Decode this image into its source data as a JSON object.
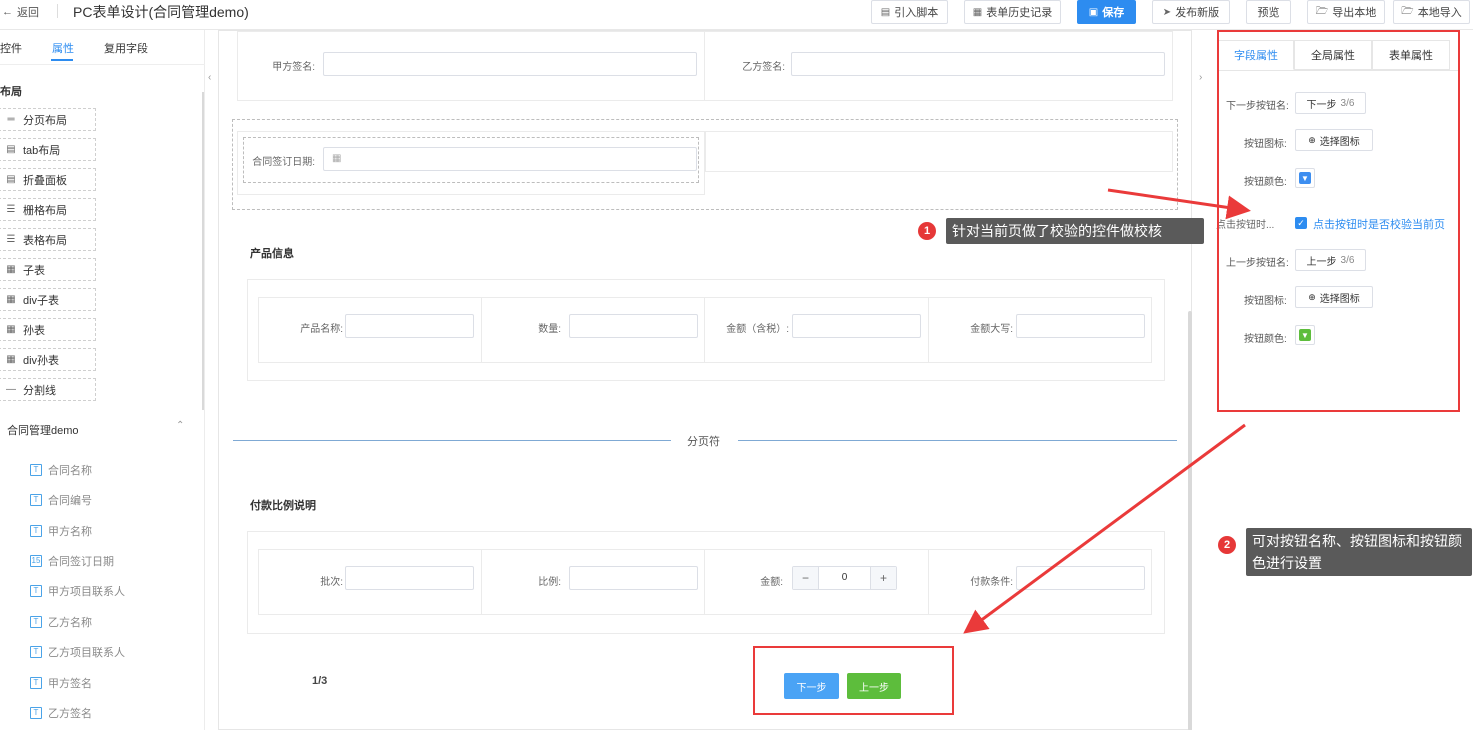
{
  "header": {
    "back_label": "返回",
    "title": "PC表单设计(合同管理demo)",
    "buttons": {
      "import_script": "引入脚本",
      "history": "表单历史记录",
      "save": "保存",
      "publish": "发布新版",
      "preview": "预览",
      "export": "导出本地",
      "import_local": "本地导入"
    }
  },
  "left": {
    "tabs": {
      "controls": "控件",
      "props": "属性",
      "reuse": "复用字段"
    },
    "layout_heading": "布局",
    "components": [
      {
        "label": "分页布局",
        "icon": "page-layout-icon"
      },
      {
        "label": "tab布局",
        "icon": "tab-layout-icon"
      },
      {
        "label": "折叠面板",
        "icon": "collapse-panel-icon"
      },
      {
        "label": "栅格布局",
        "icon": "grid-layout-icon"
      },
      {
        "label": "表格布局",
        "icon": "table-layout-icon"
      },
      {
        "label": "子表",
        "icon": "subtable-icon"
      },
      {
        "label": "div子表",
        "icon": "div-subtable-icon"
      },
      {
        "label": "孙表",
        "icon": "grandchild-table-icon"
      },
      {
        "label": "div孙表",
        "icon": "div-grandchild-table-icon"
      },
      {
        "label": "分割线",
        "icon": "divider-icon"
      }
    ],
    "group_title": "合同管理demo",
    "fields": [
      {
        "label": "合同名称",
        "icon": "T"
      },
      {
        "label": "合同编号",
        "icon": "T"
      },
      {
        "label": "甲方名称",
        "icon": "T"
      },
      {
        "label": "合同签订日期",
        "icon": "15"
      },
      {
        "label": "甲方项目联系人",
        "icon": "T"
      },
      {
        "label": "乙方名称",
        "icon": "T"
      },
      {
        "label": "乙方项目联系人",
        "icon": "T"
      },
      {
        "label": "甲方签名",
        "icon": "T"
      },
      {
        "label": "乙方签名",
        "icon": "T"
      }
    ]
  },
  "canvas": {
    "party_a_sign": "甲方签名:",
    "party_b_sign": "乙方签名:",
    "sign_date": "合同签订日期:",
    "product_section": "产品信息",
    "product_name": "产品名称:",
    "quantity": "数量:",
    "amount_tax": "金额（含税）:",
    "amount_upper": "金额大写:",
    "page_break": "分页符",
    "payment_section": "付款比例说明",
    "batch": "批次:",
    "ratio": "比例:",
    "amount": "金额:",
    "amount_value": "0",
    "pay_condition": "付款条件:",
    "page_indicator": "1/3",
    "next_button": "下一步",
    "prev_button": "上一步",
    "next_color": "#4aa3f5",
    "prev_color": "#5dbd3c"
  },
  "right": {
    "tabs": {
      "field": "字段属性",
      "global": "全局属性",
      "form": "表单属性"
    },
    "next_name_label": "下一步按钮名:",
    "next_name_value": "下一步",
    "next_name_count": "3/6",
    "icon_label": "按钮图标:",
    "choose_icon": "选择图标",
    "color_label": "按钮颜色:",
    "validate_label": "点击按钮时...",
    "validate_checkbox": "点击按钮时是否校验当前页",
    "prev_name_label": "上一步按钮名:",
    "prev_name_value": "上一步",
    "prev_name_count": "3/6",
    "prev_icon_label": "按钮图标:",
    "prev_color_label": "按钮颜色:",
    "next_swatch_color": "#3d8ef0",
    "prev_swatch_color": "#5dbd3c"
  },
  "annotations": {
    "tip1_num": "1",
    "tip1_text": "针对当前页做了校验的控件做校核",
    "tip2_num": "2",
    "tip2_text": "可对按钮名称、按钮图标和按钮颜色进行设置"
  }
}
